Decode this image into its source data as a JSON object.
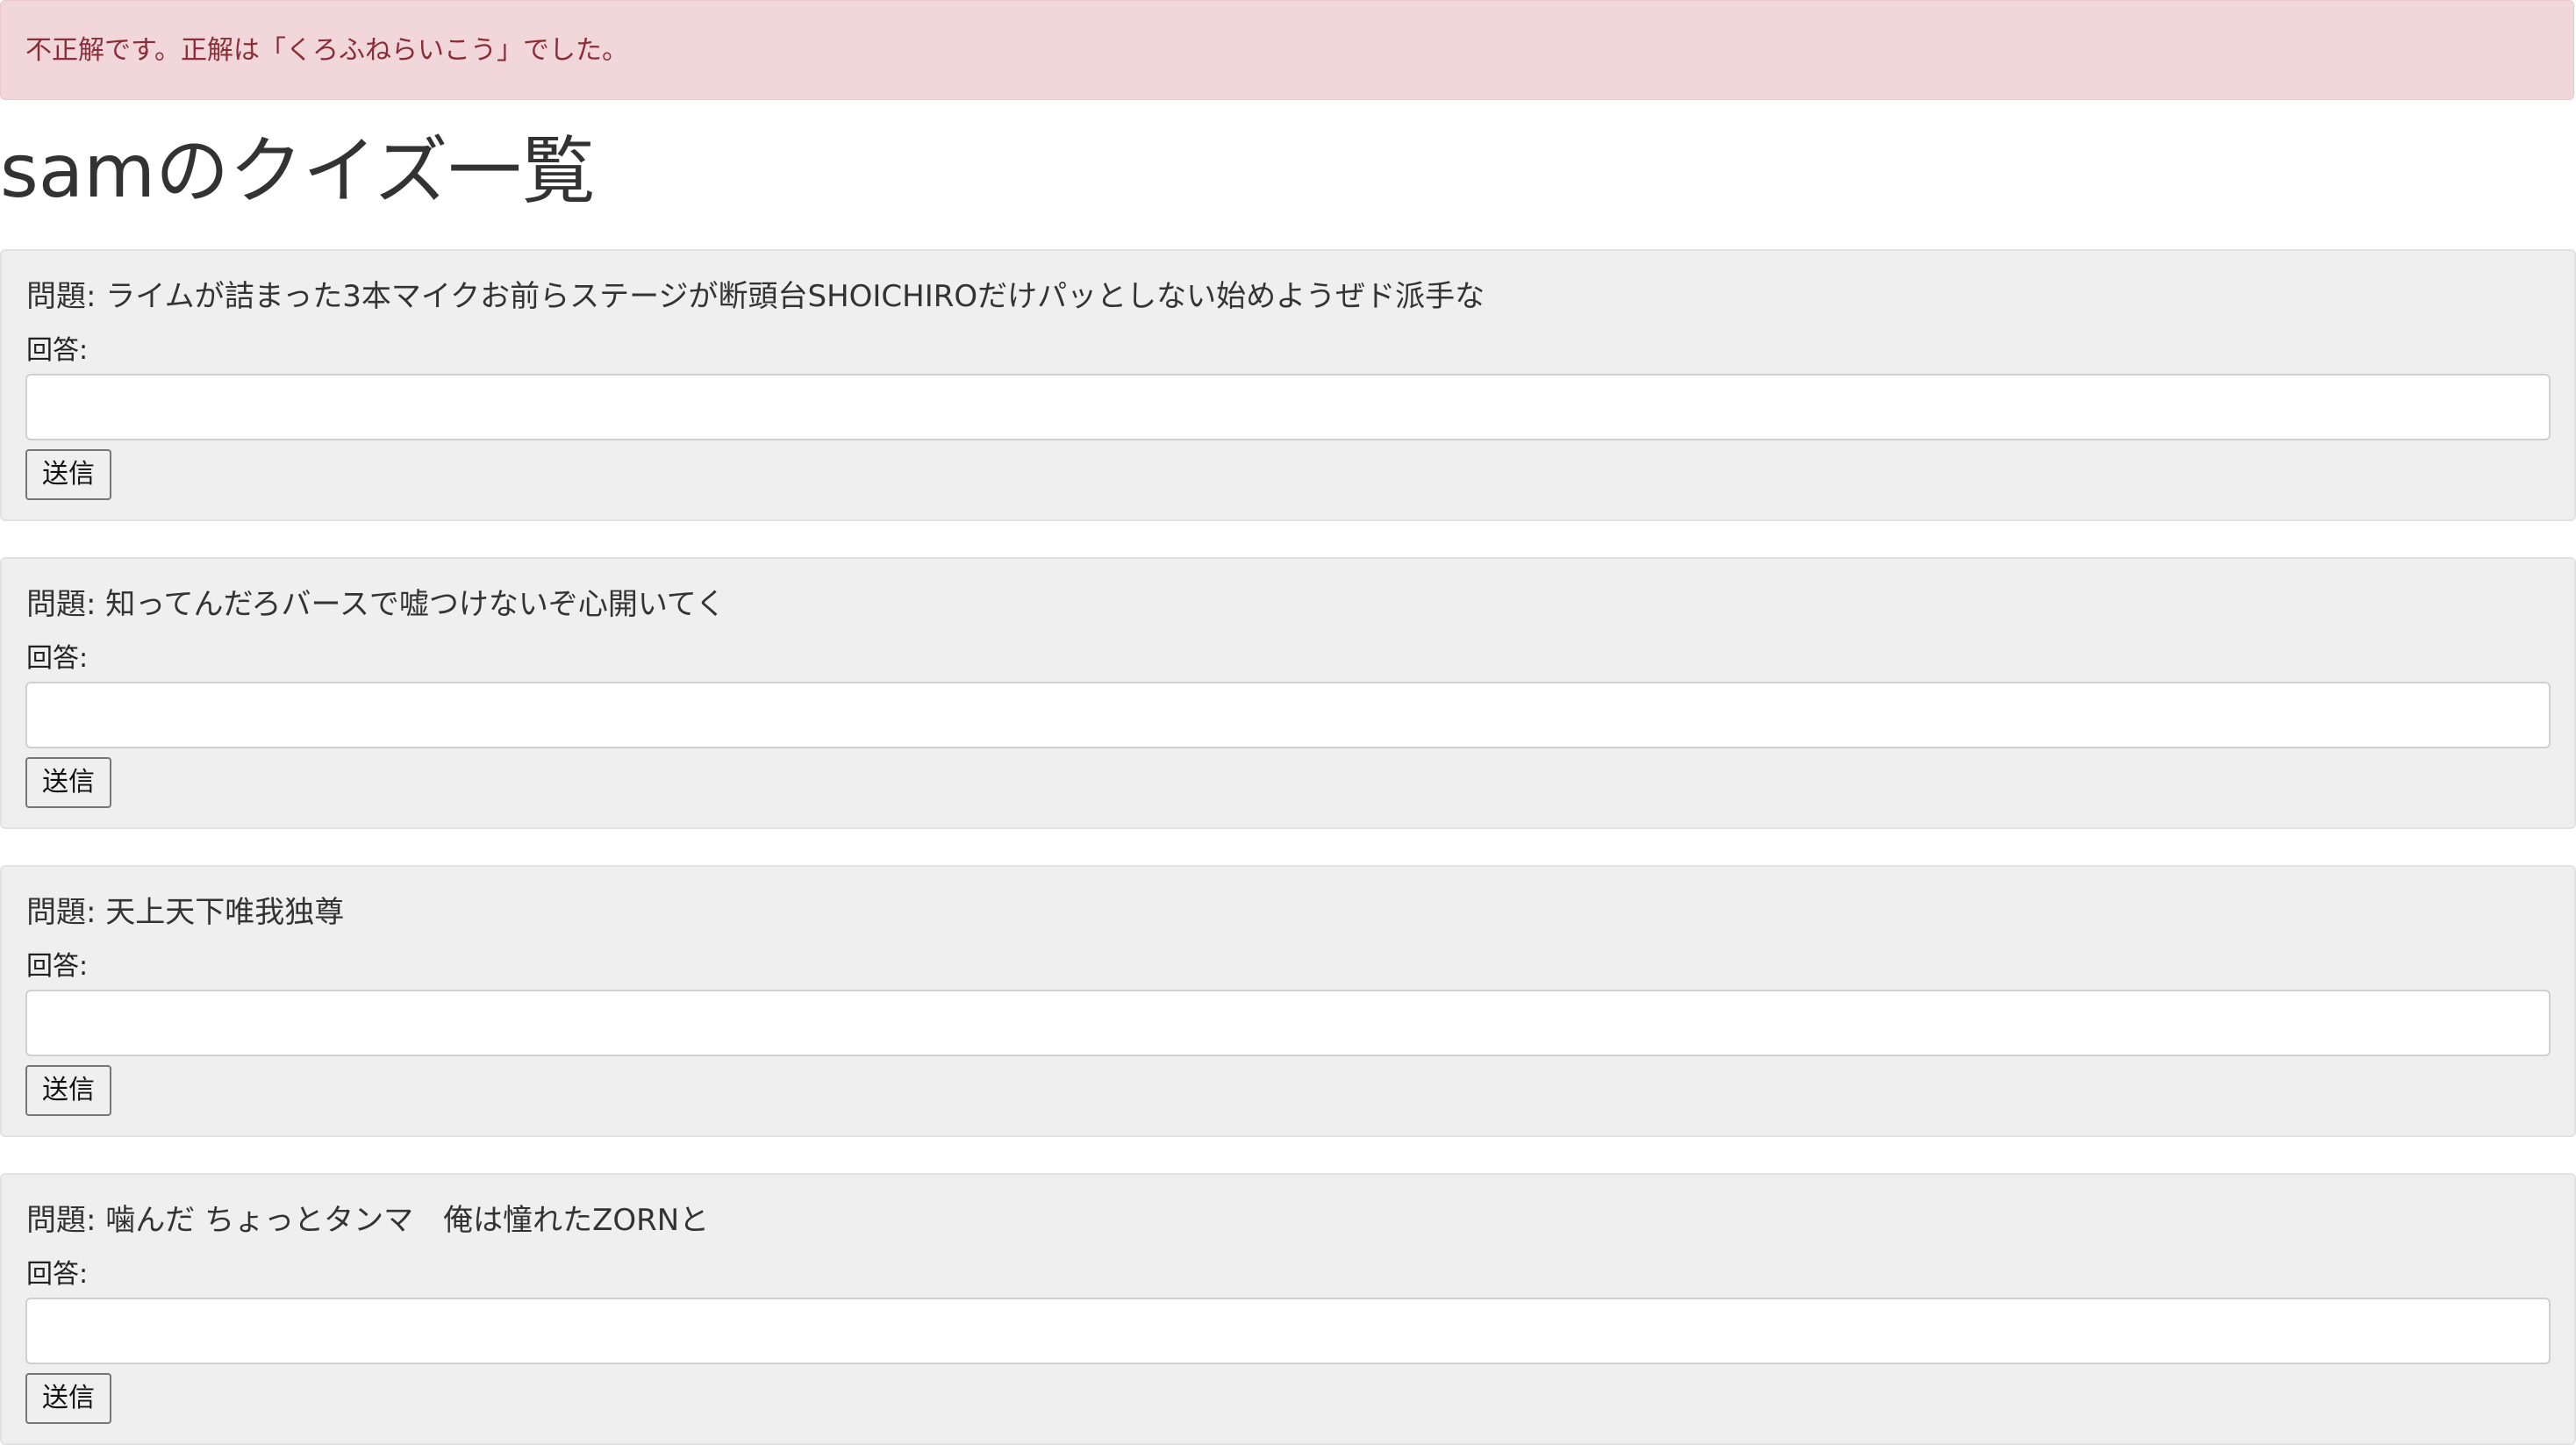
{
  "alert": {
    "message": "不正解です。正解は「くろふねらいこう」でした。"
  },
  "page": {
    "title": "samのクイズ一覧"
  },
  "quizzes": [
    {
      "question": "問題: ライムが詰まった3本マイクお前らステージが断頭台SHOICHIROだけパッとしない始めようぜド派手な",
      "answer_label": "回答:",
      "answer_value": "",
      "submit_label": "送信"
    },
    {
      "question": "問題: 知ってんだろバースで嘘つけないぞ心開いてく",
      "answer_label": "回答:",
      "answer_value": "",
      "submit_label": "送信"
    },
    {
      "question": "問題: 天上天下唯我独尊",
      "answer_label": "回答:",
      "answer_value": "",
      "submit_label": "送信"
    },
    {
      "question": "問題: 噛んだ ちょっとタンマ　俺は憧れたZORNと",
      "answer_label": "回答:",
      "answer_value": "",
      "submit_label": "送信"
    }
  ]
}
